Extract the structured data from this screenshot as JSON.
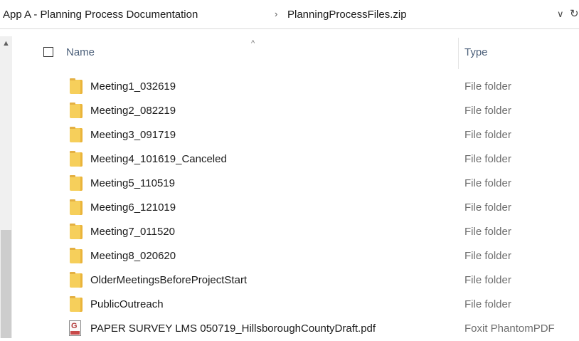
{
  "address_bar": {
    "crumbs": [
      "App A - Planning Process Documentation",
      "PlanningProcessFiles.zip"
    ],
    "separator_icon": "chevron-right-icon",
    "dropdown_icon": "chevron-down-icon",
    "refresh_icon": "refresh-icon"
  },
  "columns": {
    "name_label": "Name",
    "type_label": "Type",
    "sort_icon": "sort-ascending-caret-icon"
  },
  "files": [
    {
      "name": "Meeting1_032619",
      "type": "File folder",
      "icon": "folder-icon"
    },
    {
      "name": "Meeting2_082219",
      "type": "File folder",
      "icon": "folder-icon"
    },
    {
      "name": "Meeting3_091719",
      "type": "File folder",
      "icon": "folder-icon"
    },
    {
      "name": "Meeting4_101619_Canceled",
      "type": "File folder",
      "icon": "folder-icon"
    },
    {
      "name": "Meeting5_110519",
      "type": "File folder",
      "icon": "folder-icon"
    },
    {
      "name": "Meeting6_121019",
      "type": "File folder",
      "icon": "folder-icon"
    },
    {
      "name": "Meeting7_011520",
      "type": "File folder",
      "icon": "folder-icon"
    },
    {
      "name": "Meeting8_020620",
      "type": "File folder",
      "icon": "folder-icon"
    },
    {
      "name": "OlderMeetingsBeforeProjectStart",
      "type": "File folder",
      "icon": "folder-icon"
    },
    {
      "name": "PublicOutreach",
      "type": "File folder",
      "icon": "folder-icon"
    },
    {
      "name": "PAPER SURVEY LMS 050719_HillsboroughCountyDraft.pdf",
      "type": "Foxit PhantomPDF",
      "icon": "pdf-file-icon"
    }
  ],
  "colors": {
    "folder": "#f6cf5b",
    "header_text": "#4c607a",
    "type_text": "#6d6d6d"
  }
}
